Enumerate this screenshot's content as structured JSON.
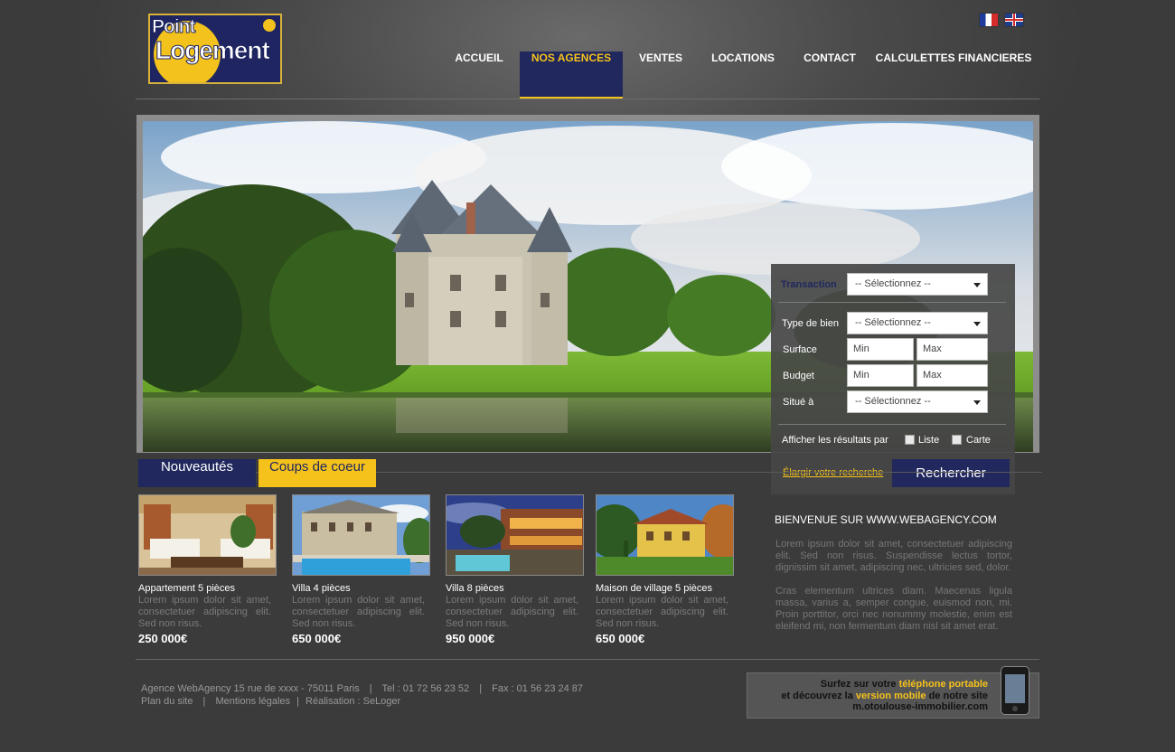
{
  "brand": {
    "logo_line1": "Point",
    "logo_line2": "Logement"
  },
  "languages": [
    {
      "code": "fr",
      "icon": "flag-fr-icon"
    },
    {
      "code": "en",
      "icon": "flag-uk-icon"
    }
  ],
  "nav": {
    "items": [
      {
        "label": "ACCUEIL"
      },
      {
        "label": "NOS AGENCES",
        "active": true
      },
      {
        "label": "VENTES"
      },
      {
        "label": "LOCATIONS"
      },
      {
        "label": "CONTACT"
      },
      {
        "label": "CALCULETTES FINANCIERES"
      }
    ]
  },
  "search": {
    "transaction_label": "Transaction",
    "transaction_value": "-- Sélectionnez --",
    "type_label": "Type de bien",
    "type_value": "-- Sélectionnez --",
    "surface_label": "Surface",
    "budget_label": "Budget",
    "situe_label": "Situé à",
    "situe_value": "-- Sélectionnez --",
    "min_placeholder": "Min",
    "max_placeholder": "Max",
    "display_label": "Afficher les résultats par",
    "opt_list": "Liste",
    "opt_map": "Carte",
    "extend_link": "Élargir votre recherche",
    "submit": "Rechercher"
  },
  "tabs": [
    {
      "label": "Nouveautés"
    },
    {
      "label": "Coups de coeur"
    }
  ],
  "listings": [
    {
      "title": "Appartement 5 pièces",
      "desc1": "Lorem ipsum dolor sit amet,",
      "desc2": "consectetuer adipiscing elit.",
      "desc3": "Sed non risus.",
      "price": "250 000€"
    },
    {
      "title": "Villa 4 pièces",
      "desc1": "Lorem ipsum dolor sit amet,",
      "desc2": "consectetuer adipiscing elit.",
      "desc3": "Sed non risus.",
      "price": "650 000€"
    },
    {
      "title": "Villa 8 pièces",
      "desc1": "Lorem ipsum dolor sit amet,",
      "desc2": "consectetuer adipiscing elit.",
      "desc3": "Sed non risus.",
      "price": "950 000€"
    },
    {
      "title": "Maison de village 5 pièces",
      "desc1": "Lorem ipsum dolor sit amet,",
      "desc2": "consectetuer adipiscing elit.",
      "desc3": "Sed non risus.",
      "price": "650 000€"
    }
  ],
  "welcome": {
    "title": "BIENVENUE SUR WWW.WEBAGENCY.COM",
    "p1": "Lorem ipsum dolor sit amet, consectetuer adipiscing elit. Sed non risus. Suspendisse lectus tortor, dignissim sit amet, adipiscing nec, ultricies sed, dolor.",
    "p2": "Cras elementum ultrices diam. Maecenas ligula massa, varius a, semper congue, euismod non, mi. Proin porttitor, orci nec nonummy molestie, enim est eleifend mi, non fermentum diam nisl sit amet erat."
  },
  "footer": {
    "address": "Agence WebAgency 15 rue de xxxx - 75011 Paris",
    "tel": "Tel : 01 72 56 23 52",
    "fax": "Fax : 01 56 23 24 87",
    "sep": "|",
    "plan": "Plan du site",
    "mentions": "Mentions légales",
    "realisation": "Réalisation : SeLoger"
  },
  "mobile": {
    "l1_a": "Surfez sur votre ",
    "l1_b": "téléphone portable",
    "l2_a": "et découvrez la ",
    "l2_b": "version mobile",
    "l2_c": " de notre site",
    "l3": "m.otoulouse-immobilier.com"
  },
  "colors": {
    "navy": "#20285d",
    "gold": "#f5c21c",
    "background": "#3a3a3a"
  }
}
